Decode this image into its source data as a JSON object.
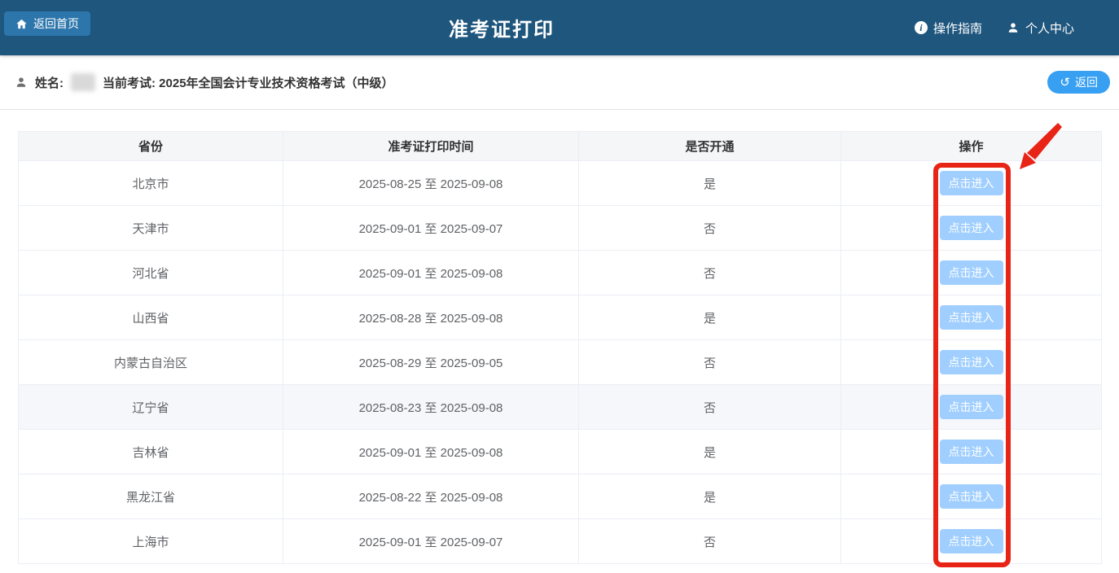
{
  "header": {
    "back_home_label": "返回首页",
    "title": "准考证打印",
    "guide_label": "操作指南",
    "profile_label": "个人中心"
  },
  "subheader": {
    "name_label": "姓名:",
    "exam_label": "当前考试: 2025年全国会计专业技术资格考试（中级）",
    "back_label": "返回"
  },
  "table": {
    "columns": [
      "省份",
      "准考证打印时间",
      "是否开通",
      "操作"
    ],
    "action_label": "点击进入",
    "rows": [
      {
        "province": "北京市",
        "period": "2025-08-25 至 2025-09-08",
        "open": "是",
        "highlighted": false
      },
      {
        "province": "天津市",
        "period": "2025-09-01 至 2025-09-07",
        "open": "否",
        "highlighted": false
      },
      {
        "province": "河北省",
        "period": "2025-09-01 至 2025-09-08",
        "open": "否",
        "highlighted": false
      },
      {
        "province": "山西省",
        "period": "2025-08-28 至 2025-09-08",
        "open": "是",
        "highlighted": false
      },
      {
        "province": "内蒙古自治区",
        "period": "2025-08-29 至 2025-09-05",
        "open": "否",
        "highlighted": false
      },
      {
        "province": "辽宁省",
        "period": "2025-08-23 至 2025-09-08",
        "open": "否",
        "highlighted": true
      },
      {
        "province": "吉林省",
        "period": "2025-09-01 至 2025-09-08",
        "open": "是",
        "highlighted": false
      },
      {
        "province": "黑龙江省",
        "period": "2025-08-22 至 2025-09-08",
        "open": "是",
        "highlighted": false
      },
      {
        "province": "上海市",
        "period": "2025-09-01 至 2025-09-07",
        "open": "否",
        "highlighted": false
      }
    ]
  },
  "colors": {
    "topbar_bg": "#1f567d",
    "back_home_btn": "#2d76ab",
    "return_btn": "#38a0f2",
    "enter_btn": "#a0cfff",
    "annotation_red": "#e82417",
    "table_border": "#ebeef5",
    "row_highlight": "#f5f7fa"
  }
}
